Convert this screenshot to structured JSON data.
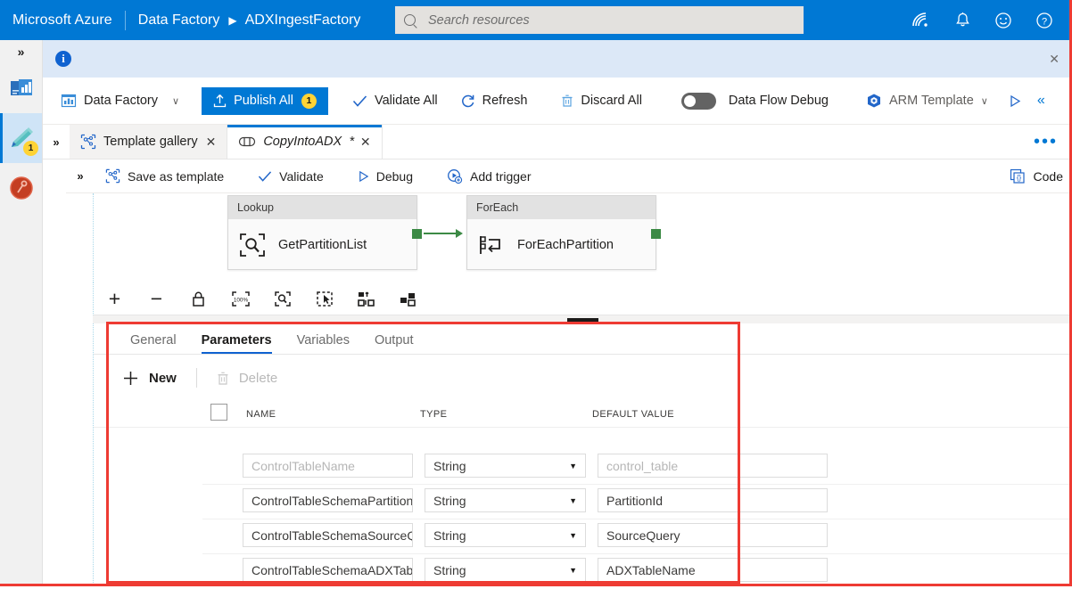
{
  "azure_bar": {
    "brand": "Microsoft Azure",
    "breadcrumb_service": "Data Factory",
    "breadcrumb_arrow": "▶",
    "breadcrumb_resource": "ADXIngestFactory",
    "search_placeholder": "Search resources",
    "icons": [
      "cloud-shell-icon",
      "notifications-bell-icon",
      "feedback-smiley-icon",
      "help-question-icon"
    ]
  },
  "left_rail": {
    "expand_label": "»",
    "items": [
      {
        "name": "monitor-overview-icon",
        "badge": ""
      },
      {
        "name": "author-pencil-icon",
        "badge": "1"
      },
      {
        "name": "manage-icon",
        "badge": ""
      }
    ]
  },
  "info_bar": {
    "icon": "info-icon",
    "message": "",
    "close_label": "✕"
  },
  "main_toolbar": {
    "factory_label": "Data Factory",
    "factory_chevron": "∨",
    "publish_label": "Publish All",
    "publish_count": "1",
    "validate_all_label": "Validate All",
    "refresh_label": "Refresh",
    "discard_all_label": "Discard All",
    "data_flow_debug_label": "Data Flow Debug",
    "data_flow_debug_state": "off",
    "arm_template_label": "ARM Template",
    "arm_chevron": "∨",
    "run_icon": "play-triangle-icon",
    "collapse_icon": "double-chevron-left-icon"
  },
  "tab_strip": {
    "expand_label": "»",
    "tabs": [
      {
        "label": "Template gallery",
        "icon": "template-gallery-icon",
        "dirty": "",
        "close": "✕",
        "active": false
      },
      {
        "label": "CopyIntoADX",
        "icon": "pipeline-icon",
        "dirty": "*",
        "close": "✕",
        "active": true
      }
    ],
    "overflow_label": "•••"
  },
  "pipeline_toolbar": {
    "expand_label": "»",
    "save_as_template_label": "Save as template",
    "validate_label": "Validate",
    "debug_label": "Debug",
    "add_trigger_label": "Add trigger",
    "code_label": "Code"
  },
  "canvas": {
    "nodes": [
      {
        "type": "Lookup",
        "name": "GetPartitionList",
        "icon": "lookup-magnifier-icon"
      },
      {
        "type": "ForEach",
        "name": "ForEachPartition",
        "icon": "foreach-loop-icon"
      }
    ],
    "connector_color": "#3c8a45"
  },
  "zoom_toolbar": {
    "buttons": [
      {
        "name": "zoom-in-icon",
        "glyph": "+"
      },
      {
        "name": "zoom-out-icon",
        "glyph": "−"
      },
      {
        "name": "lock-icon",
        "glyph": ""
      },
      {
        "name": "zoom-to-100-percent-icon",
        "glyph": "100%"
      },
      {
        "name": "zoom-to-fit-icon",
        "glyph": ""
      },
      {
        "name": "select-mode-icon",
        "glyph": ""
      },
      {
        "name": "auto-align-icon",
        "glyph": ""
      },
      {
        "name": "activity-layout-icon",
        "glyph": ""
      }
    ]
  },
  "properties_panel": {
    "tabs": [
      {
        "label": "General",
        "active": false
      },
      {
        "label": "Parameters",
        "active": true
      },
      {
        "label": "Variables",
        "active": false
      },
      {
        "label": "Output",
        "active": false
      }
    ],
    "commands": {
      "new_label": "New",
      "new_icon": "plus-icon",
      "delete_label": "Delete",
      "delete_icon": "trash-icon",
      "delete_disabled": true
    },
    "grid": {
      "columns": [
        "NAME",
        "TYPE",
        "DEFAULT VALUE"
      ],
      "select_all_checked": false,
      "rows": [
        {
          "name": "ControlTableName",
          "type": "String",
          "default": "control_table"
        },
        {
          "name": "ControlTableSchemaPartition",
          "type": "String",
          "default": "PartitionId"
        },
        {
          "name": "ControlTableSchemaSourceQ",
          "type": "String",
          "default": "SourceQuery"
        },
        {
          "name": "ControlTableSchemaADXTabl",
          "type": "String",
          "default": "ADXTableName"
        }
      ]
    }
  },
  "annotation": {
    "highlight_color": "#ee3b33"
  }
}
